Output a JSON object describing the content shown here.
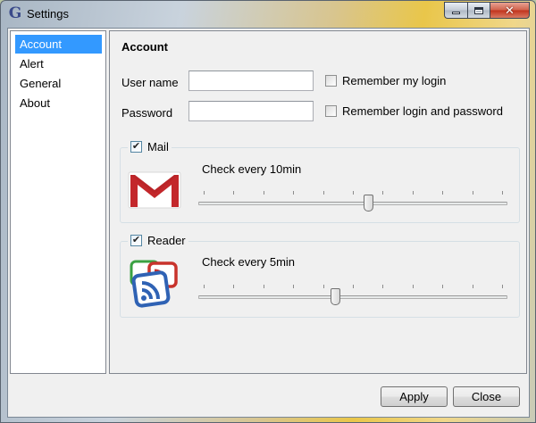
{
  "window": {
    "title": "Settings",
    "app_icon": "G"
  },
  "sidebar": {
    "items": [
      {
        "label": "Account",
        "selected": true
      },
      {
        "label": "Alert",
        "selected": false
      },
      {
        "label": "General",
        "selected": false
      },
      {
        "label": "About",
        "selected": false
      }
    ]
  },
  "account": {
    "title": "Account",
    "username_label": "User name",
    "username_value": "",
    "password_label": "Password",
    "password_value": "",
    "remember_login_label": "Remember my login",
    "remember_login_checked": false,
    "remember_both_label": "Remember login and password",
    "remember_both_checked": false
  },
  "mail": {
    "label": "Mail",
    "checked": true,
    "interval_text": "Check every 10min",
    "slider_ticks": 11,
    "slider_value_fraction": 0.55
  },
  "reader": {
    "label": "Reader",
    "checked": true,
    "interval_text": "Check every 5min",
    "slider_ticks": 11,
    "slider_value_fraction": 0.44
  },
  "footer": {
    "apply_label": "Apply",
    "close_label": "Close"
  },
  "colors": {
    "selection": "#3399ff",
    "gmail_red": "#c3272b",
    "reader_blue": "#2f62b4",
    "reader_red": "#c8332c",
    "reader_green": "#3aa142"
  },
  "icons": {
    "minimize": "minimize-icon",
    "maximize": "maximize-icon",
    "close": "close-icon",
    "mail": "gmail-icon",
    "reader": "google-reader-icon",
    "check": "✔"
  }
}
